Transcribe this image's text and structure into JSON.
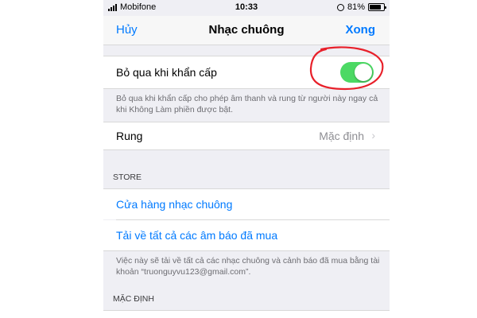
{
  "status_bar": {
    "carrier": "Mobifone",
    "time": "10:33",
    "battery_percent": "81%",
    "battery_level": 0.81
  },
  "nav": {
    "cancel": "Hủy",
    "title": "Nhạc chuông",
    "done": "Xong"
  },
  "emergency_bypass": {
    "label": "Bỏ qua khi khẩn cấp",
    "enabled": true,
    "toggle_color": "#4cd964",
    "footer": "Bỏ qua khi khẩn cấp cho phép âm thanh và rung từ người này ngay cả khi Không Làm phiền được bật."
  },
  "vibration": {
    "label": "Rung",
    "value": "Mặc định"
  },
  "store": {
    "header": "STORE",
    "items": [
      {
        "label": "Cửa hàng nhạc chuông"
      },
      {
        "label": "Tải về tất cả các âm báo đã mua"
      }
    ],
    "footer": "Việc này sẽ tải về tất cả các nhạc chuông và cảnh báo đã mua bằng tài khoản “truonguyvu123@gmail.com”."
  },
  "default_section": {
    "header": "MẶC ĐỊNH"
  },
  "colors": {
    "accent": "#007aff",
    "annotation": "#e8202a"
  }
}
